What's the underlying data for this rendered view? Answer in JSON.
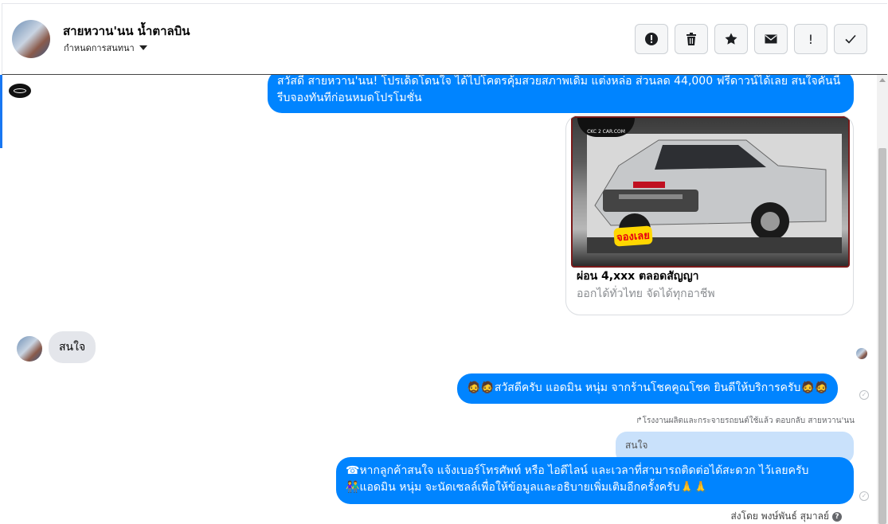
{
  "header": {
    "contact_name": "สายหวาน'นน น้ำตาลบิน",
    "status_label": "กำหนดการสนทนา",
    "tools": {
      "report_icon": "alert-circle-icon",
      "delete_icon": "trash-icon",
      "star_icon": "star-icon",
      "mail_icon": "envelope-icon",
      "important_label": "!",
      "done_icon": "check-icon"
    }
  },
  "messages": {
    "greeting": "สวัสดี สายหวาน'นน! โปรเด็ดโดนใจ ได้ไปโคตรคุ้มสวยสภาพเดิม แต่งหล่อ  ส่วนลด 44,000 ฟรีดาวน์ได้เลย สนใจคันนี้ รีบจองทันทีก่อนหมดโปรโมชั่น",
    "card_image_brand": "CKC 2 CAR.COM",
    "card_image_stamp": "จองเลย",
    "card_title": "ผ่อน 4,xxx ตลอดสัญญา",
    "card_subtitle": "ออกได้ทั่วไทย จัดได้ทุกอาชีพ",
    "customer_reply": "สนใจ",
    "admin_hello": "สวัสดีครับ แอดมิน หนุ่ม จากร้านโชคคูณโชค ยินดีให้บริการครับ",
    "reply_note": "โรงงานผลิตและกระจายรถยนต์ใช้แล้ว ตอบกลับ สายหวาน'นน",
    "quoted_text": "สนใจ",
    "admin_request_line1": "หากลูกค้าสนใจ แจ้งเบอร์โทรศัพท์ หรือ ไอดีไลน์ และเวลาที่สามารถติดต่อได้สะดวก ไว้เลยครับ",
    "admin_request_line2": "แอดมิน หนุ่ม จะนัดเซลล์เพื่อให้ข้อมูลและอธิบายเพิ่มเติมอีกครั้งครับ",
    "sent_by": "ส่งโดย พงษ์พันธ์ สุมาลย์"
  },
  "colors": {
    "outgoing_bubble": "#0084ff",
    "incoming_bubble": "#e4e6eb",
    "quoted_bubble": "#c9e1fb"
  }
}
